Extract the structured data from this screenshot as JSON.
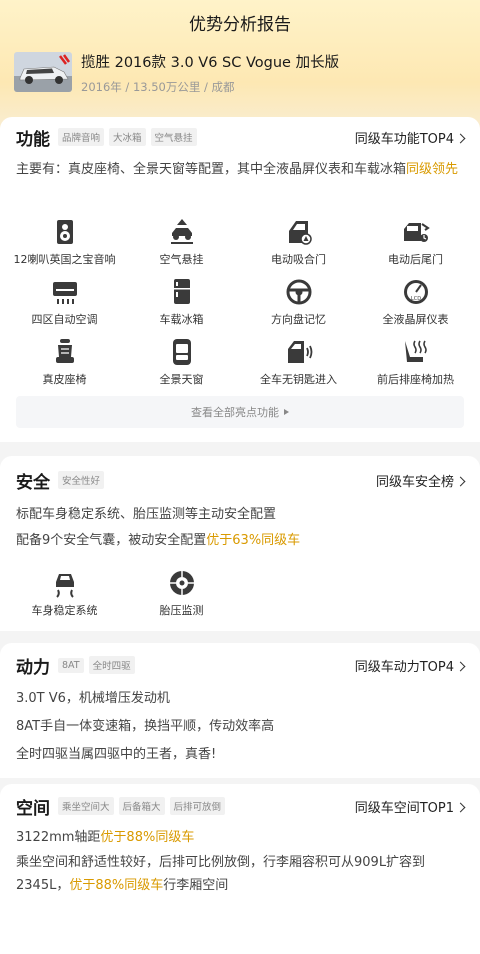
{
  "header": {
    "title": "优势分析报告"
  },
  "car": {
    "name": "揽胜 2016款 3.0 V6 SC Vogue 加长版",
    "meta": "2016年 / 13.50万公里 / 成都"
  },
  "function": {
    "title": "功能",
    "tags": [
      "品牌音响",
      "大冰箱",
      "空气悬挂"
    ],
    "link": "同级车功能TOP4",
    "desc_main": "主要有：真皮座椅、全景天窗等配置，其中全液晶屏仪表和车载冰箱",
    "desc_hl": "同级领先",
    "features": [
      {
        "label": "12喇叭英国之宝音响",
        "icon": "speaker-icon"
      },
      {
        "label": "空气悬挂",
        "icon": "air-suspension-icon"
      },
      {
        "label": "电动吸合门",
        "icon": "soft-close-door-icon"
      },
      {
        "label": "电动后尾门",
        "icon": "power-tailgate-icon"
      },
      {
        "label": "四区自动空调",
        "icon": "climate-icon"
      },
      {
        "label": "车载冰箱",
        "icon": "fridge-icon"
      },
      {
        "label": "方向盘记忆",
        "icon": "steering-wheel-icon"
      },
      {
        "label": "全液晶屏仪表",
        "icon": "lcd-gauge-icon"
      },
      {
        "label": "真皮座椅",
        "icon": "leather-seat-icon"
      },
      {
        "label": "全景天窗",
        "icon": "sunroof-icon"
      },
      {
        "label": "全车无钥匙进入",
        "icon": "keyless-entry-icon"
      },
      {
        "label": "前后排座椅加热",
        "icon": "seat-heating-icon"
      }
    ],
    "view_all": "查看全部亮点功能"
  },
  "safety": {
    "title": "安全",
    "tags": [
      "安全性好"
    ],
    "link": "同级车安全榜",
    "line1": "标配车身稳定系统、胎压监测等主动安全配置",
    "line2_pre": "配备9个安全气囊，被动安全配置",
    "line2_hl": "优于63%同级车",
    "features": [
      {
        "label": "车身稳定系统",
        "icon": "esp-icon"
      },
      {
        "label": "胎压监测",
        "icon": "tire-pressure-icon"
      }
    ]
  },
  "power": {
    "title": "动力",
    "tags": [
      "8AT",
      "全时四驱"
    ],
    "link": "同级车动力TOP4",
    "lines": [
      "3.0T V6，机械增压发动机",
      "8AT手自一体变速箱，换挡平顺，传动效率高",
      "全时四驱当属四驱中的王者，真香!"
    ]
  },
  "space": {
    "title": "空间",
    "tags": [
      "乘坐空间大",
      "后备箱大",
      "后排可放倒"
    ],
    "link": "同级车空间TOP1",
    "line1_pre": "3122mm轴距",
    "line1_hl": "优于88%同级车",
    "line2": "乘坐空间和舒适性较好，后排可比例放倒，行李厢容积可从909L扩容到",
    "line3_pre": "2345L，",
    "line3_hl": "优于88%同级车",
    "line3_post": "行李厢空间"
  },
  "colors": {
    "accent": "#d99a00",
    "header_bg": "#fde8b3"
  }
}
